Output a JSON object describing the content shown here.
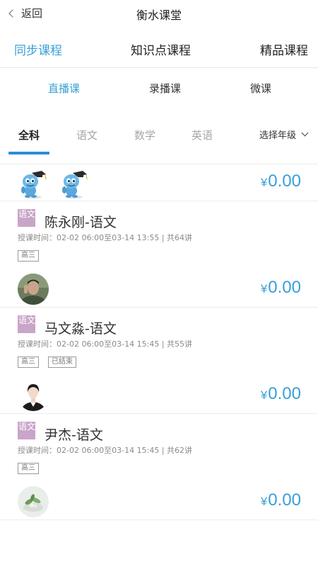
{
  "header": {
    "back_label": "返回",
    "title": "衡水课堂"
  },
  "category_tabs": [
    {
      "label": "同步课程",
      "active": true
    },
    {
      "label": "知识点课程",
      "active": false
    },
    {
      "label": "精品课程",
      "active": false
    }
  ],
  "type_tabs": [
    {
      "label": "直播课",
      "active": true
    },
    {
      "label": "录播课",
      "active": false
    },
    {
      "label": "微课",
      "active": false
    }
  ],
  "subject_tabs": [
    {
      "label": "全科",
      "active": true
    },
    {
      "label": "语文",
      "active": false
    },
    {
      "label": "数学",
      "active": false
    },
    {
      "label": "英语",
      "active": false
    }
  ],
  "grade_select": {
    "label": "选择年级"
  },
  "colors": {
    "accent": "#3a9fd8",
    "badge": "#c9a5c9",
    "underline": "#2a8fd6"
  },
  "top_row": {
    "price_symbol": "¥",
    "price": "0.00",
    "avatar": "mascot-figures"
  },
  "courses": [
    {
      "badge": "语文",
      "name": "陈永刚-语文",
      "meta": "授课时间：02-02 06:00至03-14 13:55  |  共64讲",
      "tags": [
        "高三"
      ],
      "price_symbol": "¥",
      "price": "0.00",
      "avatar": "teacher-photo-man"
    },
    {
      "badge": "语文",
      "name": "马文淼-语文",
      "meta": "授课时间：02-02 06:00至03-14 15:45  |  共55讲",
      "tags": [
        "高三",
        "已结束"
      ],
      "price_symbol": "¥",
      "price": "0.00",
      "avatar": "teacher-photo-woman"
    },
    {
      "badge": "语文",
      "name": "尹杰-语文",
      "meta": "授课时间：02-02 06:00至03-14 15:45  |  共62讲",
      "tags": [
        "高三"
      ],
      "price_symbol": "¥",
      "price": "0.00",
      "avatar": "plant-photo"
    }
  ]
}
